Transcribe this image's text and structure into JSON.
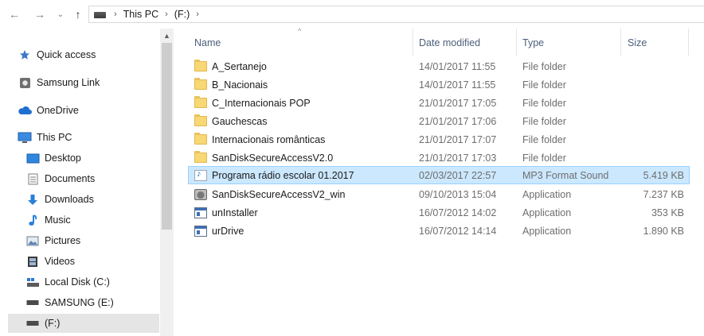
{
  "address_bar": {
    "back_glyph": "←",
    "forward_glyph": "→",
    "recent_glyph": "⌄",
    "up_glyph": "↑",
    "separator": "›",
    "crumbs": [
      "This PC",
      "(F:)"
    ]
  },
  "sidebar": {
    "items": [
      {
        "label": "Quick access",
        "icon": "star-icon"
      },
      {
        "label": "Samsung Link",
        "icon": "samsung-link-icon"
      },
      {
        "label": "OneDrive",
        "icon": "cloud-icon"
      },
      {
        "label": "This PC",
        "icon": "computer-icon"
      },
      {
        "label": "Desktop",
        "icon": "desktop-icon"
      },
      {
        "label": "Documents",
        "icon": "documents-icon"
      },
      {
        "label": "Downloads",
        "icon": "download-icon"
      },
      {
        "label": "Music",
        "icon": "music-icon"
      },
      {
        "label": "Pictures",
        "icon": "pictures-icon"
      },
      {
        "label": "Videos",
        "icon": "videos-icon"
      },
      {
        "label": "Local Disk (C:)",
        "icon": "local-disk-icon"
      },
      {
        "label": "SAMSUNG (E:)",
        "icon": "drive-icon"
      },
      {
        "label": "(F:)",
        "icon": "drive-icon"
      }
    ]
  },
  "file_list": {
    "columns": {
      "name": "Name",
      "date": "Date modified",
      "type": "Type",
      "size": "Size"
    },
    "sort_glyph": "^",
    "rows": [
      {
        "name": "A_Sertanejo",
        "date": "14/01/2017 11:55",
        "type": "File folder",
        "size": "",
        "icon": "folder-icon"
      },
      {
        "name": "B_Nacionais",
        "date": "14/01/2017 11:55",
        "type": "File folder",
        "size": "",
        "icon": "folder-icon"
      },
      {
        "name": "C_Internacionais POP",
        "date": "21/01/2017 17:05",
        "type": "File folder",
        "size": "",
        "icon": "folder-icon"
      },
      {
        "name": "Gauchescas",
        "date": "21/01/2017 17:06",
        "type": "File folder",
        "size": "",
        "icon": "folder-icon"
      },
      {
        "name": "Internacionais românticas",
        "date": "21/01/2017 17:07",
        "type": "File folder",
        "size": "",
        "icon": "folder-icon"
      },
      {
        "name": "SanDiskSecureAccessV2.0",
        "date": "21/01/2017 17:03",
        "type": "File folder",
        "size": "",
        "icon": "folder-icon"
      },
      {
        "name": "Programa rádio escolar 01.2017",
        "date": "02/03/2017 22:57",
        "type": "MP3 Format Sound",
        "size": "5.419 KB",
        "icon": "audio-file-icon"
      },
      {
        "name": "SanDiskSecureAccessV2_win",
        "date": "09/10/2013 15:04",
        "type": "Application",
        "size": "7.237 KB",
        "icon": "sandisk-app-icon"
      },
      {
        "name": "unInstaller",
        "date": "16/07/2012 14:02",
        "type": "Application",
        "size": "353 KB",
        "icon": "application-icon"
      },
      {
        "name": "urDrive",
        "date": "16/07/2012 14:14",
        "type": "Application",
        "size": "1.890 KB",
        "icon": "application-icon"
      }
    ]
  },
  "colors": {
    "selection_bg": "#cce8ff",
    "selection_border": "#99d1ff",
    "header_text": "#4c607a"
  }
}
